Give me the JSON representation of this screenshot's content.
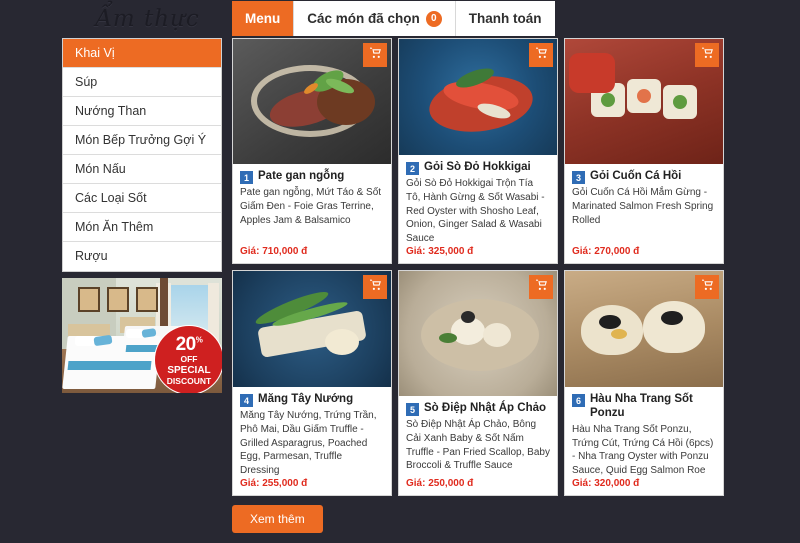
{
  "brand": {
    "logo_text": "Ẩm thực"
  },
  "tabs": [
    {
      "label": "Menu",
      "active": true,
      "badge": null
    },
    {
      "label": "Các món đã chọn",
      "active": false,
      "badge": "0"
    },
    {
      "label": "Thanh toán",
      "active": false,
      "badge": null
    }
  ],
  "sidebar": {
    "categories": [
      {
        "label": "Khai Vị",
        "active": true
      },
      {
        "label": "Súp",
        "active": false
      },
      {
        "label": "Nướng Than",
        "active": false
      },
      {
        "label": "Món Bếp Trưởng Gợi Ý",
        "active": false
      },
      {
        "label": "Món Nấu",
        "active": false
      },
      {
        "label": "Các Loại Sốt",
        "active": false
      },
      {
        "label": "Món Ăn Thêm",
        "active": false
      },
      {
        "label": "Rượu",
        "active": false
      }
    ],
    "promo": {
      "alt": "hotel-room-photo",
      "percent": "20",
      "percent_sup": "%",
      "off": "OFF",
      "line1": "SPECIAL",
      "line2": "DISCOUNT"
    }
  },
  "dishes": [
    {
      "num": "1",
      "name": "Pate gan ngỗng",
      "desc": "Pate gan ngỗng, Mứt Táo & Sốt Giấm Đen - Foie Gras Terrine, Apples Jam & Balsamico",
      "price": "Giá: 710,000 đ",
      "cart_icon": "cart-icon",
      "plate": "plate-dark"
    },
    {
      "num": "2",
      "name": "Gỏi Sò Đỏ Hokkigai",
      "desc": "Gỏi Sò Đỏ Hokkigai Trộn Tía Tô, Hành Gừng & Sốt Wasabi - Red Oyster with Shosho Leaf, Onion, Ginger Salad & Wasabi Sauce",
      "price": "Giá: 325,000 đ",
      "cart_icon": "cart-icon",
      "plate": "plate-blue"
    },
    {
      "num": "3",
      "name": "Gỏi Cuốn Cá Hồi",
      "desc": "Gỏi Cuốn Cá Hồi Mắm Gừng - Marinated Salmon Fresh Spring Rolled",
      "price": "Giá: 270,000 đ",
      "cart_icon": "cart-icon",
      "plate": "plate-red"
    },
    {
      "num": "4",
      "name": "Măng Tây Nướng",
      "desc": "Măng Tây Nướng, Trứng Trần, Phô Mai, Dầu Giấm Truffle - Grilled Asparagrus, Poached Egg, Parmesan, Truffle Dressing",
      "price": "Giá: 255,000 đ",
      "cart_icon": "cart-icon",
      "plate": "plate-navy"
    },
    {
      "num": "5",
      "name": "Sò Điệp Nhật Áp Chảo",
      "desc": "Sò Điệp Nhật Áp Chảo, Bông Cải Xanh Baby & Sốt Nấm Truffle - Pan Fried Scallop, Baby Broccoli & Truffle Sauce",
      "price": "Giá: 250,000 đ",
      "cart_icon": "cart-icon",
      "plate": "plate-cream"
    },
    {
      "num": "6",
      "name": "Hàu Nha Trang Sốt Ponzu",
      "desc": "Hàu Nha Trang Sốt Ponzu, Trứng Cút, Trứng Cá Hồi (6pcs) - Nha Trang Oyster with Ponzu Sauce, Quid Egg Salmon Roe",
      "price": "Giá: 320,000 đ",
      "cart_icon": "cart-icon",
      "plate": "plate-wood"
    }
  ],
  "footer": {
    "more_label": "Xem thêm"
  },
  "colors": {
    "accent_orange": "#ed6b23",
    "price_red": "#e02b1e",
    "badge_blue": "#2f6cb5",
    "page_bg": "#282832"
  }
}
